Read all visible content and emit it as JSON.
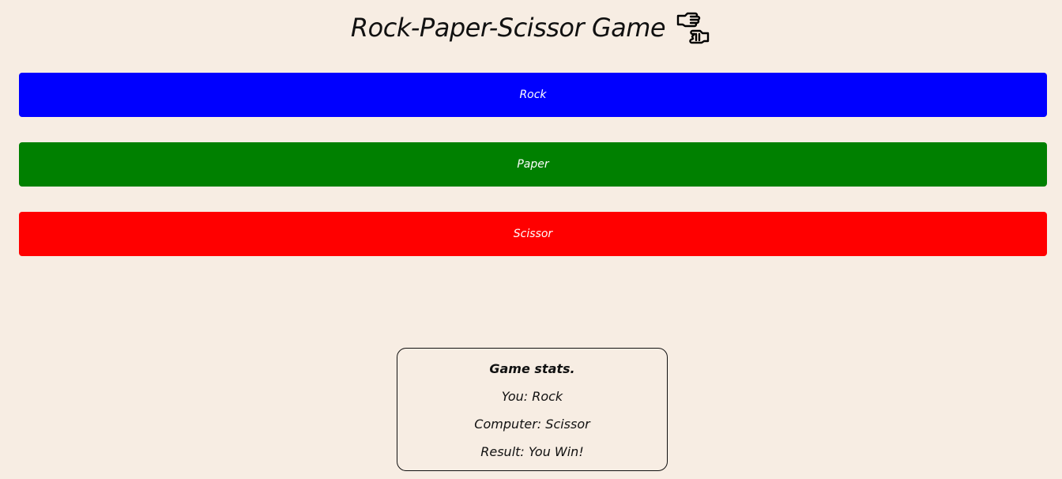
{
  "header": {
    "title": "Rock-Paper-Scissor Game",
    "icon": "rock-paper-scissors-hands-icon"
  },
  "choices": {
    "rock": {
      "label": "Rock",
      "color": "#0000ff"
    },
    "paper": {
      "label": "Paper",
      "color": "#008000"
    },
    "scissor": {
      "label": "Scissor",
      "color": "#ff0000"
    }
  },
  "stats": {
    "heading": "Game stats.",
    "you": "You: Rock",
    "computer": "Computer: Scissor",
    "result": "Result: You Win!"
  },
  "colors": {
    "background": "#f7ede3",
    "text": "#111111"
  }
}
